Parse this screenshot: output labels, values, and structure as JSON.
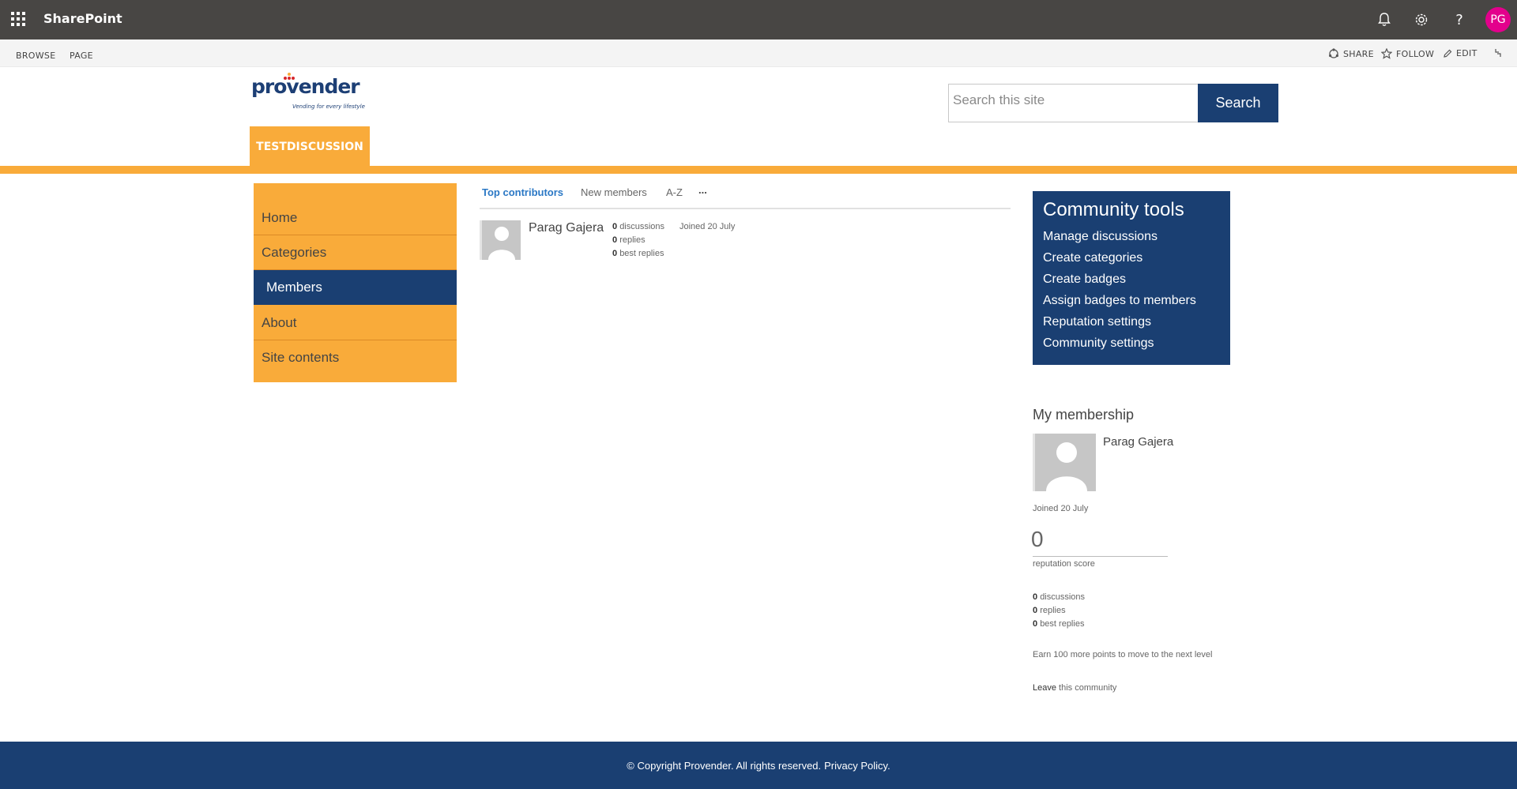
{
  "suitebar": {
    "app_name": "SharePoint",
    "user_initials": "PG"
  },
  "ribbon": {
    "tabs": [
      "BROWSE",
      "PAGE"
    ],
    "actions": {
      "share": "SHARE",
      "follow": "FOLLOW",
      "edit": "EDIT"
    }
  },
  "header": {
    "logo_text": "provender",
    "logo_tagline": "Vending for every lifestyle",
    "search_placeholder": "Search this site",
    "search_button": "Search",
    "site_tab": "TESTDISCUSSION"
  },
  "leftnav": {
    "items": [
      "Home",
      "Categories",
      "Members",
      "About",
      "Site contents"
    ],
    "active": "Members"
  },
  "members": {
    "tabs": [
      "Top contributors",
      "New members",
      "A-Z",
      "..."
    ],
    "list": [
      {
        "name": "Parag Gajera",
        "discussions": "0",
        "discussions_label": "discussions",
        "replies": "0",
        "replies_label": "replies",
        "best_replies": "0",
        "best_replies_label": "best replies",
        "joined": "Joined 20 July"
      }
    ]
  },
  "community_tools": {
    "title": "Community tools",
    "links": [
      "Manage discussions",
      "Create categories",
      "Create badges",
      "Assign badges to members",
      "Reputation settings",
      "Community settings"
    ]
  },
  "membership": {
    "title": "My membership",
    "name": "Parag Gajera",
    "joined": "Joined 20 July",
    "score": "0",
    "score_label": "reputation score",
    "discussions": "0",
    "discussions_label": "discussions",
    "replies": "0",
    "replies_label": "replies",
    "best_replies": "0",
    "best_replies_label": "best replies",
    "next_level": "Earn 100 more points to move to the next level",
    "leave": "Leave",
    "leave_rest": "this community"
  },
  "footer": {
    "copyright": "© Copyright Provender. All rights reserved.",
    "privacy": "Privacy Policy."
  },
  "colors": {
    "suitebar": "#484644",
    "accent_orange": "#f9ab3a",
    "brand_navy": "#1a3f72",
    "avatar": "#e3008c"
  }
}
